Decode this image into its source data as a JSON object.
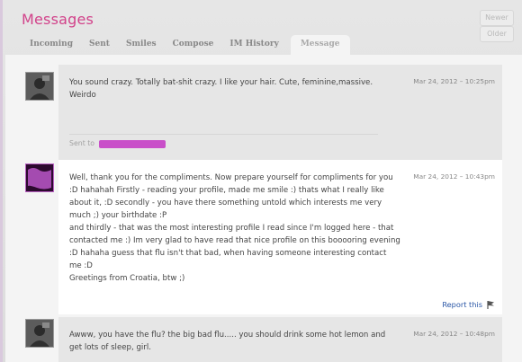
{
  "header": {
    "title": "Messages",
    "newer_label": "Newer",
    "older_label": "Older"
  },
  "tabs": [
    {
      "label": "Incoming"
    },
    {
      "label": "Sent"
    },
    {
      "label": "Smiles"
    },
    {
      "label": "Compose"
    },
    {
      "label": "IM History"
    },
    {
      "label": "Message",
      "active": true
    }
  ],
  "messages": [
    {
      "text": "You sound crazy. Totally bat-shit crazy. I like your hair. Cute, feminine,massive. Weirdo",
      "date": "Mar 24, 2012 – 10:25pm",
      "sent_to_label": "Sent to"
    },
    {
      "text": "Well, thank you for the compliments. Now prepare yourself for compliments for you :D hahahah Firstly - reading your profile, made me smile :) thats what I really like about it, :D secondly - you have there something untold which interests me very much ;) your birthdate :P\nand thirdly - that was the most interesting profile I read since I'm logged here - that contacted me :) Im very glad to have read that nice profile on this booooring evening :D hahaha guess that flu isn't that bad, when having someone interesting contact me :D\nGreetings from Croatia, btw ;)",
      "date": "Mar 24, 2012 – 10:43pm",
      "report_label": "Report this"
    },
    {
      "text": "Awww, you have the flu? the big bad flu..... you should drink some hot lemon and get lots of sleep, girl.",
      "date": "Mar 24, 2012 – 10:48pm"
    }
  ],
  "colors": {
    "title": "#d2428a",
    "link": "#2a56a6",
    "redaction": "#c94fc9"
  }
}
